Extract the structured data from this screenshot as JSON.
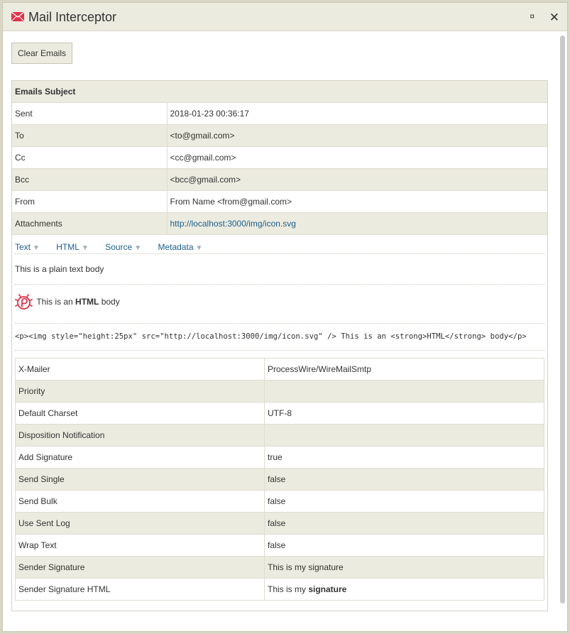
{
  "window": {
    "title": "Mail Interceptor",
    "pin_glyph": "¤",
    "close_glyph": "✕"
  },
  "toolbar": {
    "clear_label": "Clear Emails"
  },
  "email": {
    "subject_header": "Emails Subject",
    "fields": [
      {
        "key": "Sent",
        "value": "2018-01-23 00:36:17"
      },
      {
        "key": "To",
        "value": "<to@gmail.com>"
      },
      {
        "key": "Cc",
        "value": "<cc@gmail.com>"
      },
      {
        "key": "Bcc",
        "value": "<bcc@gmail.com>"
      },
      {
        "key": "From",
        "value": "From Name <from@gmail.com>"
      },
      {
        "key": "Attachments",
        "value": "http://localhost:3000/img/icon.svg"
      }
    ]
  },
  "tabs": [
    {
      "label": "Text",
      "arrow": "▼"
    },
    {
      "label": "HTML",
      "arrow": "▼"
    },
    {
      "label": "Source",
      "arrow": "▼"
    },
    {
      "label": "Metadata",
      "arrow": "▼"
    }
  ],
  "body": {
    "text": "This is a plain text body",
    "html_pre": "This is an ",
    "html_strong": "HTML",
    "html_post": " body",
    "source": "<p><img style=\"height:25px\" src=\"http://localhost:3000/img/icon.svg\" /> This is an <strong>HTML</strong> body</p>"
  },
  "metadata": [
    {
      "key": "X-Mailer",
      "value": "ProcessWire/WireMailSmtp"
    },
    {
      "key": "Priority",
      "value": ""
    },
    {
      "key": "Default Charset",
      "value": "UTF-8"
    },
    {
      "key": "Disposition Notification",
      "value": ""
    },
    {
      "key": "Add Signature",
      "value": "true"
    },
    {
      "key": "Send Single",
      "value": "false"
    },
    {
      "key": "Send Bulk",
      "value": "false"
    },
    {
      "key": "Use Sent Log",
      "value": "false"
    },
    {
      "key": "Wrap Text",
      "value": "false"
    },
    {
      "key": "Sender Signature",
      "value": "This is my signature"
    },
    {
      "key": "Sender Signature HTML",
      "value_pre": "This is my ",
      "value_strong": "signature"
    }
  ],
  "colors": {
    "accent_link": "#1c5f8c",
    "row_alt": "#ecebe0",
    "icon_red": "#e0324b"
  }
}
